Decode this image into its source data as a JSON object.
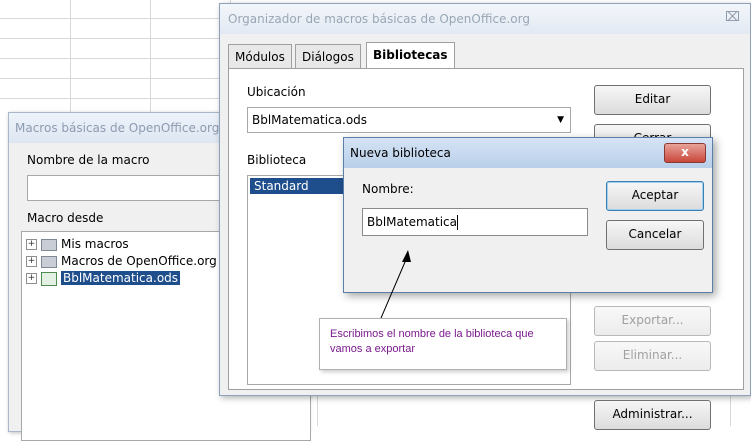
{
  "organizer": {
    "title": "Organizador de macros básicas de OpenOffice.org",
    "close": "⌧",
    "tabs": [
      "Módulos",
      "Diálogos",
      "Bibliotecas"
    ],
    "location_label": "Ubicación",
    "location_value": "BblMatematica.ods",
    "library_label": "Biblioteca",
    "library_items": [
      "Standard"
    ],
    "buttons": {
      "edit": "Editar",
      "close_btn": "Cerrar",
      "export": "Exportar...",
      "delete": "Eliminar...",
      "manage": "Administrar..."
    }
  },
  "macro_window": {
    "title": "Macros básicas de OpenOffice.org",
    "name_label": "Nombre de la macro",
    "from_label": "Macro desde",
    "tree": [
      "Mis macros",
      "Macros de OpenOffice.org",
      "BblMatematica.ods"
    ]
  },
  "new_library": {
    "title": "Nueva biblioteca",
    "close": "x",
    "name_label": "Nombre:",
    "name_value": "BblMatematica",
    "ok": "Aceptar",
    "cancel": "Cancelar"
  },
  "callout": {
    "text": "Escribimos el nombre de la biblioteca que vamos a exportar"
  },
  "colors": {
    "selection": "#1f4e8c",
    "callout_text": "#7a1a8c"
  }
}
